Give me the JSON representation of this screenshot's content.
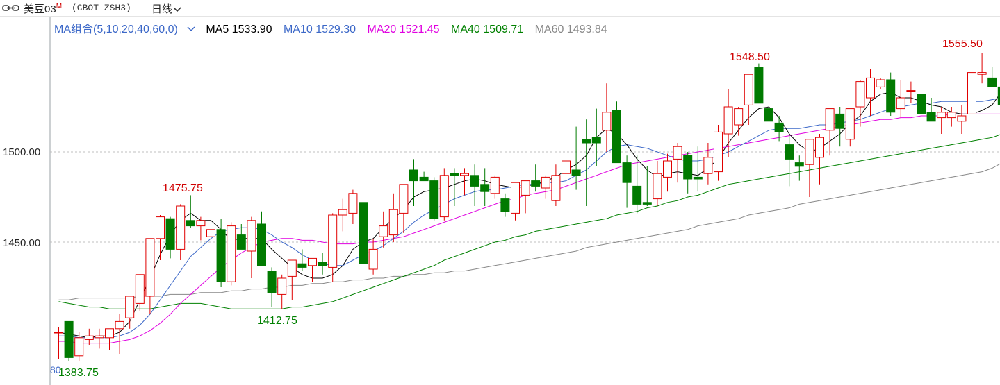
{
  "header": {
    "symbol": "美豆03",
    "symbol_flag": "M",
    "code": "(CBOT ZSH3)",
    "period": "日线",
    "icons": [
      "link-icon",
      "chevron-down-icon"
    ]
  },
  "ma_legend": {
    "combo": "MA组合(5,10,20,40,60,0)",
    "items": [
      {
        "label": "MA5 1533.90",
        "color": "#000000"
      },
      {
        "label": "MA10 1529.30",
        "color": "#3c68c8"
      },
      {
        "label": "MA20 1521.45",
        "color": "#e000e0"
      },
      {
        "label": "MA40 1509.71",
        "color": "#008000"
      },
      {
        "label": "MA60 1493.84",
        "color": "#888888"
      }
    ]
  },
  "y_axis_labels": [
    "1500.00",
    "1450.00"
  ],
  "annotations": {
    "high1": "1475.75",
    "low1": "1412.75",
    "high2": "1548.50",
    "high3": "1555.50",
    "low0": "1383.75"
  },
  "bottom_strip": "80",
  "colors": {
    "up": "#e00000",
    "down": "#007a00"
  },
  "chart_data": {
    "type": "candlestick",
    "ylim": [
      1380,
      1563
    ],
    "gridlines": [
      1450,
      1500
    ],
    "candles": [
      [
        1400,
        1403,
        1385,
        1400
      ],
      [
        1406,
        1406,
        1384,
        1386
      ],
      [
        1387,
        1400,
        1384,
        1397
      ],
      [
        1396,
        1402,
        1393,
        1398
      ],
      [
        1397,
        1402,
        1391,
        1398
      ],
      [
        1397,
        1402,
        1390,
        1402
      ],
      [
        1402,
        1410,
        1388,
        1406
      ],
      [
        1408,
        1418,
        1402,
        1420
      ],
      [
        1416,
        1432,
        1412,
        1432
      ],
      [
        1420,
        1450,
        1410,
        1452
      ],
      [
        1452,
        1465,
        1440,
        1464
      ],
      [
        1463,
        1464,
        1441,
        1446
      ],
      [
        1446,
        1471,
        1440,
        1470
      ],
      [
        1462,
        1476,
        1458,
        1459
      ],
      [
        1459,
        1464,
        1451,
        1462
      ],
      [
        1453,
        1461,
        1446,
        1457
      ],
      [
        1457,
        1463,
        1425,
        1428
      ],
      [
        1428,
        1461,
        1426,
        1459
      ],
      [
        1454,
        1460,
        1448,
        1446
      ],
      [
        1445,
        1464,
        1430,
        1462
      ],
      [
        1460,
        1467,
        1438,
        1437
      ],
      [
        1434,
        1436,
        1414,
        1422
      ],
      [
        1421,
        1432,
        1413,
        1430
      ],
      [
        1431,
        1440,
        1418,
        1440
      ],
      [
        1438,
        1446,
        1434,
        1436
      ],
      [
        1437,
        1441,
        1428,
        1441
      ],
      [
        1439,
        1444,
        1432,
        1437
      ],
      [
        1436,
        1466,
        1428,
        1465
      ],
      [
        1465,
        1474,
        1456,
        1468
      ],
      [
        1466,
        1479,
        1460,
        1477
      ],
      [
        1472,
        1477,
        1434,
        1438
      ],
      [
        1435,
        1452,
        1432,
        1446
      ],
      [
        1453,
        1467,
        1447,
        1459
      ],
      [
        1454,
        1477,
        1450,
        1468
      ],
      [
        1466,
        1482,
        1455,
        1482
      ],
      [
        1490,
        1496,
        1470,
        1484
      ],
      [
        1486,
        1489,
        1484,
        1484
      ],
      [
        1484,
        1486,
        1462,
        1463
      ],
      [
        1464,
        1491,
        1462,
        1487
      ],
      [
        1488,
        1491,
        1470,
        1487
      ],
      [
        1487,
        1491,
        1476,
        1488
      ],
      [
        1487,
        1493,
        1470,
        1481
      ],
      [
        1482,
        1491,
        1470,
        1478
      ],
      [
        1477,
        1487,
        1474,
        1486
      ],
      [
        1474,
        1477,
        1464,
        1467
      ],
      [
        1466,
        1483,
        1462,
        1483
      ],
      [
        1476,
        1484,
        1466,
        1484
      ],
      [
        1484,
        1493,
        1478,
        1481
      ],
      [
        1480,
        1487,
        1474,
        1486
      ],
      [
        1473,
        1493,
        1470,
        1487
      ],
      [
        1488,
        1502,
        1476,
        1495
      ],
      [
        1490,
        1514,
        1479,
        1487
      ],
      [
        1507,
        1518,
        1470,
        1505
      ],
      [
        1508,
        1524,
        1492,
        1505
      ],
      [
        1512,
        1538,
        1500,
        1522
      ],
      [
        1523,
        1528,
        1495,
        1494
      ],
      [
        1494,
        1498,
        1469,
        1483
      ],
      [
        1481,
        1498,
        1466,
        1471
      ],
      [
        1472,
        1492,
        1470,
        1471
      ],
      [
        1474,
        1495,
        1470,
        1488
      ],
      [
        1486,
        1499,
        1478,
        1495
      ],
      [
        1496,
        1505,
        1483,
        1503
      ],
      [
        1498,
        1500,
        1477,
        1485
      ],
      [
        1486,
        1503,
        1478,
        1485
      ],
      [
        1488,
        1505,
        1482,
        1497
      ],
      [
        1489,
        1515,
        1484,
        1511
      ],
      [
        1510,
        1535,
        1497,
        1525
      ],
      [
        1515,
        1525,
        1509,
        1524
      ],
      [
        1526,
        1535,
        1515,
        1543
      ],
      [
        1547,
        1549,
        1529,
        1527
      ],
      [
        1524,
        1530,
        1511,
        1517
      ],
      [
        1516,
        1520,
        1506,
        1511
      ],
      [
        1504,
        1510,
        1481,
        1496
      ],
      [
        1494,
        1498,
        1484,
        1492
      ],
      [
        1493,
        1504,
        1475,
        1507
      ],
      [
        1497,
        1510,
        1482,
        1508
      ],
      [
        1512,
        1523,
        1498,
        1524
      ],
      [
        1521,
        1525,
        1503,
        1513
      ],
      [
        1507,
        1519,
        1503,
        1524
      ],
      [
        1525,
        1540,
        1514,
        1539
      ],
      [
        1530,
        1546,
        1520,
        1541
      ],
      [
        1536,
        1541,
        1535,
        1540
      ],
      [
        1540,
        1544,
        1520,
        1522
      ],
      [
        1524,
        1540,
        1519,
        1530
      ],
      [
        1534,
        1539,
        1527,
        1534
      ],
      [
        1532,
        1535,
        1520,
        1521
      ],
      [
        1522,
        1530,
        1518,
        1517
      ],
      [
        1519,
        1525,
        1510,
        1522
      ],
      [
        1519,
        1525,
        1514,
        1522
      ],
      [
        1517,
        1526,
        1510,
        1520
      ],
      [
        1521,
        1545,
        1517,
        1544
      ],
      [
        1543,
        1555,
        1538,
        1544
      ],
      [
        1541,
        1547,
        1536,
        1536
      ],
      [
        1536,
        1546,
        1524,
        1526
      ]
    ],
    "ma5": [
      1400,
      1399,
      1398,
      1397,
      1398,
      1398,
      1400,
      1406,
      1418,
      1430,
      1443,
      1454,
      1462,
      1466,
      1462,
      1462,
      1457,
      1451,
      1452,
      1452,
      1452,
      1446,
      1441,
      1436,
      1432,
      1430,
      1430,
      1432,
      1437,
      1446,
      1450,
      1452,
      1458,
      1463,
      1468,
      1475,
      1478,
      1479,
      1480,
      1482,
      1484,
      1485,
      1484,
      1482,
      1481,
      1480,
      1481,
      1482,
      1484,
      1486,
      1490,
      1493,
      1498,
      1508,
      1513,
      1510,
      1504,
      1496,
      1490,
      1486,
      1488,
      1489,
      1488,
      1487,
      1491,
      1496,
      1505,
      1512,
      1519,
      1524,
      1525,
      1519,
      1510,
      1504,
      1500,
      1502,
      1506,
      1510,
      1516,
      1520,
      1528,
      1532,
      1533,
      1530,
      1530,
      1528,
      1526,
      1525,
      1522,
      1521,
      1521,
      1523,
      1526,
      1534
    ],
    "ma10": [
      1398,
      1398,
      1397,
      1397,
      1397,
      1397,
      1398,
      1400,
      1404,
      1410,
      1418,
      1426,
      1434,
      1442,
      1447,
      1452,
      1456,
      1457,
      1458,
      1458,
      1457,
      1454,
      1450,
      1447,
      1443,
      1440,
      1438,
      1437,
      1437,
      1440,
      1443,
      1445,
      1448,
      1452,
      1456,
      1461,
      1465,
      1468,
      1471,
      1474,
      1476,
      1478,
      1479,
      1479,
      1480,
      1481,
      1482,
      1482,
      1483,
      1483,
      1484,
      1487,
      1490,
      1495,
      1500,
      1503,
      1504,
      1503,
      1502,
      1500,
      1498,
      1496,
      1495,
      1495,
      1496,
      1498,
      1500,
      1503,
      1506,
      1509,
      1512,
      1513,
      1513,
      1513,
      1514,
      1515,
      1515,
      1516,
      1517,
      1518,
      1520,
      1522,
      1524,
      1525,
      1526,
      1527,
      1527,
      1528,
      1528,
      1528,
      1528,
      1528,
      1529,
      1530
    ],
    "ma20": [
      1395,
      1395,
      1394,
      1394,
      1394,
      1394,
      1395,
      1396,
      1398,
      1401,
      1405,
      1410,
      1416,
      1421,
      1426,
      1431,
      1436,
      1440,
      1444,
      1447,
      1450,
      1451,
      1452,
      1452,
      1451,
      1451,
      1450,
      1449,
      1449,
      1449,
      1450,
      1450,
      1451,
      1452,
      1453,
      1455,
      1457,
      1459,
      1461,
      1463,
      1465,
      1467,
      1469,
      1471,
      1473,
      1474,
      1476,
      1477,
      1478,
      1479,
      1481,
      1483,
      1485,
      1487,
      1489,
      1491,
      1493,
      1494,
      1495,
      1496,
      1497,
      1498,
      1499,
      1500,
      1501,
      1502,
      1503,
      1504,
      1505,
      1506,
      1507,
      1508,
      1509,
      1510,
      1511,
      1512,
      1513,
      1514,
      1515,
      1516,
      1517,
      1518,
      1518,
      1519,
      1519,
      1520,
      1520,
      1520,
      1521,
      1521,
      1521,
      1521,
      1521,
      1521
    ],
    "ma40": [
      1417,
      1416,
      1415,
      1414,
      1414,
      1413,
      1413,
      1413,
      1413,
      1413,
      1414,
      1415,
      1416,
      1416,
      1416,
      1415,
      1414,
      1413,
      1413,
      1413,
      1413,
      1413,
      1413,
      1414,
      1414,
      1415,
      1416,
      1417,
      1419,
      1421,
      1423,
      1425,
      1427,
      1429,
      1431,
      1433,
      1435,
      1437,
      1440,
      1442,
      1444,
      1446,
      1448,
      1450,
      1451,
      1453,
      1454,
      1456,
      1457,
      1458,
      1459,
      1460,
      1461,
      1462,
      1463,
      1465,
      1466,
      1467,
      1469,
      1470,
      1472,
      1473,
      1475,
      1476,
      1478,
      1480,
      1482,
      1483,
      1484,
      1485,
      1486,
      1487,
      1488,
      1489,
      1490,
      1491,
      1492,
      1493,
      1494,
      1495,
      1496,
      1497,
      1498,
      1499,
      1500,
      1501,
      1502,
      1503,
      1504,
      1505,
      1506,
      1507,
      1508,
      1510
    ],
    "ma60": [
      1418,
      1418,
      1419,
      1419,
      1419,
      1419,
      1419,
      1419,
      1420,
      1420,
      1420,
      1421,
      1421,
      1421,
      1422,
      1422,
      1422,
      1423,
      1423,
      1424,
      1424,
      1425,
      1425,
      1426,
      1426,
      1427,
      1427,
      1428,
      1428,
      1429,
      1429,
      1430,
      1430,
      1431,
      1431,
      1432,
      1432,
      1433,
      1433,
      1434,
      1434,
      1435,
      1436,
      1437,
      1438,
      1439,
      1440,
      1441,
      1442,
      1443,
      1444,
      1445,
      1447,
      1448,
      1449,
      1450,
      1451,
      1452,
      1453,
      1454,
      1455,
      1456,
      1457,
      1459,
      1460,
      1461,
      1462,
      1463,
      1465,
      1466,
      1467,
      1468,
      1469,
      1471,
      1472,
      1473,
      1474,
      1475,
      1476,
      1477,
      1478,
      1479,
      1480,
      1481,
      1482,
      1483,
      1484,
      1485,
      1486,
      1487,
      1488,
      1489,
      1491,
      1494
    ]
  }
}
